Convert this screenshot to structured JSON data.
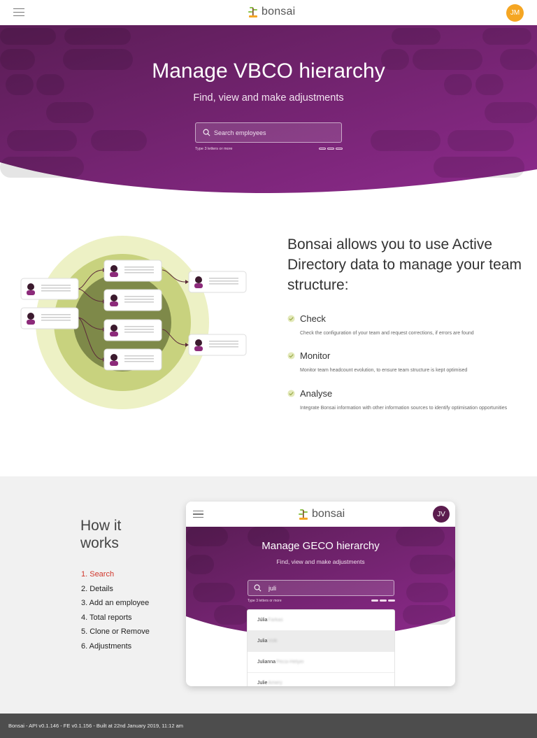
{
  "header": {
    "logo_text": "bonsai",
    "avatar_initials": "JM",
    "avatar_color": "#f5a623"
  },
  "hero": {
    "title": "Manage VBCO hierarchy",
    "subtitle": "Find, view and make adjustments",
    "search_placeholder": "Search employees",
    "search_hint": "Type 3 letters or more",
    "gradient_from": "#5c1f57",
    "gradient_to": "#8e2a8e"
  },
  "features": {
    "heading": "Bonsai allows you to use Active Directory data to manage your team structure:",
    "items": [
      {
        "title": "Check",
        "description": "Check the configuration of your team and request corrections, if errors are found"
      },
      {
        "title": "Monitor",
        "description": "Monitor team headcount evolution, to ensure team structure is kept optimised"
      },
      {
        "title": "Analyse",
        "description": "Integrate Bonsai information with other information sources to identify optimisation opportunities"
      }
    ],
    "check_color": "#b9c96b"
  },
  "how_it_works": {
    "title": "How it works",
    "steps": [
      {
        "label": "1. Search",
        "active": true
      },
      {
        "label": "2. Details",
        "active": false
      },
      {
        "label": "3. Add an employee",
        "active": false
      },
      {
        "label": "4. Total reports",
        "active": false
      },
      {
        "label": "5. Clone or Remove",
        "active": false
      },
      {
        "label": "6. Adjustments",
        "active": false
      }
    ],
    "active_color": "#d0362b",
    "preview": {
      "logo_text": "bonsai",
      "avatar_initials": "JV",
      "title": "Manage GECO hierarchy",
      "subtitle": "Find, view and make adjustments",
      "search_value": "juli",
      "search_hint": "Type 3 letters or more",
      "results": [
        {
          "name": "Júlia",
          "rest": "Farkas"
        },
        {
          "name": "Julia",
          "rest": "Volk"
        },
        {
          "name": "Julianna",
          "rest": "Pécsi-Hétyei"
        },
        {
          "name": "Julie",
          "rest": "Amery"
        }
      ]
    }
  },
  "footer": {
    "text": "Bonsai - API v0.1.146 - FE v0.1.156 - Built at 22nd January 2019, 11:12 am"
  }
}
